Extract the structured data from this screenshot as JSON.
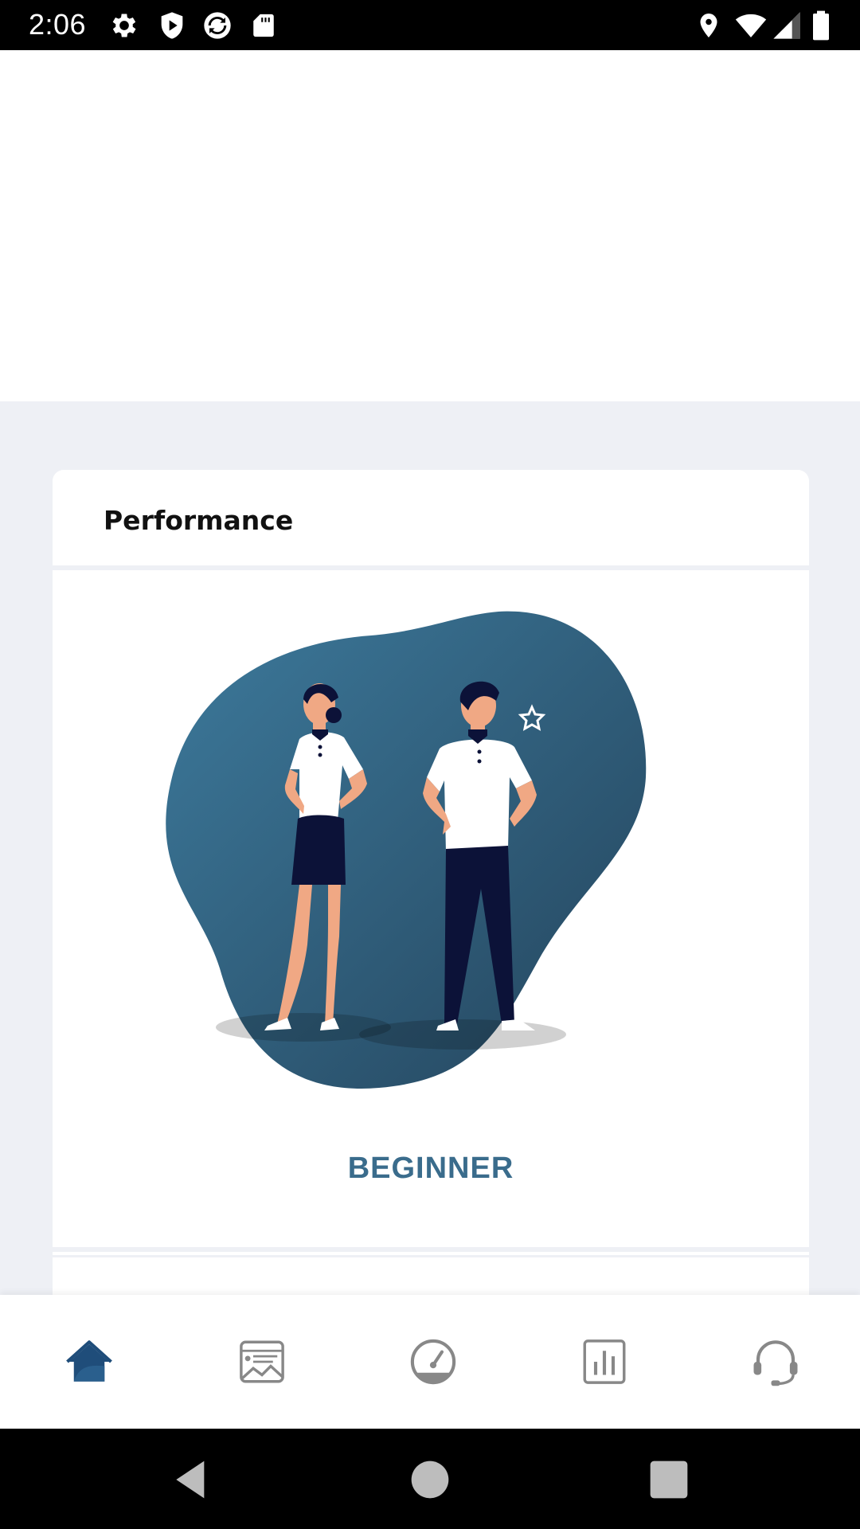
{
  "status_bar": {
    "time": "2:06",
    "left_icons": [
      "gear-icon",
      "shield-play-icon",
      "sync-icon",
      "sd-card-icon"
    ],
    "right_icons": [
      "location-icon",
      "wifi-icon",
      "signal-icon",
      "battery-icon"
    ]
  },
  "performance_card": {
    "title": "Performance",
    "level": "BEGINNER",
    "illustration": "two-people-standing-illustration"
  },
  "bottom_nav": {
    "items": [
      {
        "icon": "home-icon",
        "active": true
      },
      {
        "icon": "gallery-icon",
        "active": false
      },
      {
        "icon": "speedometer-icon",
        "active": false
      },
      {
        "icon": "bar-chart-icon",
        "active": false
      },
      {
        "icon": "headset-icon",
        "active": false
      }
    ]
  },
  "system_nav": {
    "buttons": [
      "back-icon",
      "home-circle-icon",
      "recents-icon"
    ]
  },
  "colors": {
    "accent": "#3a6c8c",
    "active_icon": "#1f4d7a",
    "inactive_icon": "#888888",
    "page_bg": "#eef0f5",
    "navy": "#0c1238"
  }
}
